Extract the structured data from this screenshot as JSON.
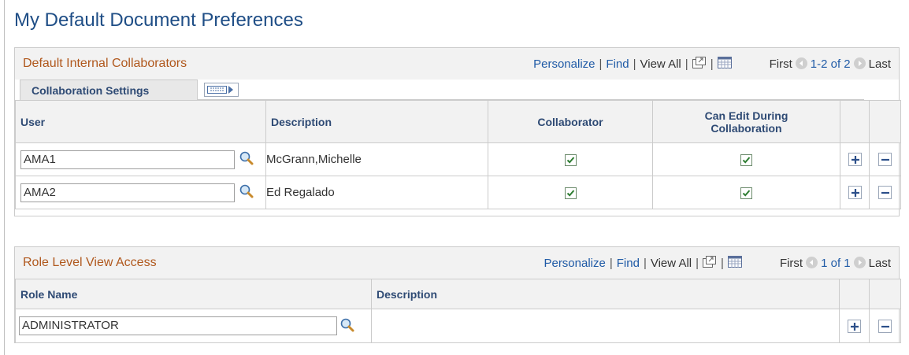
{
  "page": {
    "title": "My Default Document Preferences"
  },
  "collaborators": {
    "title": "Default Internal Collaborators",
    "nav": {
      "personalize": "Personalize",
      "find": "Find",
      "view_all": "View All",
      "first": "First",
      "range": "1-2 of 2",
      "last": "Last"
    },
    "tab": {
      "label": "Collaboration Settings"
    },
    "columns": {
      "user": "User",
      "description": "Description",
      "collaborator": "Collaborator",
      "can_edit_1": "Can Edit During",
      "can_edit_2": "Collaboration"
    },
    "rows": [
      {
        "user": "AMA1",
        "description": "McGrann,Michelle",
        "collaborator": true,
        "can_edit": true
      },
      {
        "user": "AMA2",
        "description": "Ed Regalado",
        "collaborator": true,
        "can_edit": true
      }
    ]
  },
  "roles": {
    "title": "Role Level View Access",
    "nav": {
      "personalize": "Personalize",
      "find": "Find",
      "view_all": "View All",
      "first": "First",
      "range": "1 of 1",
      "last": "Last"
    },
    "columns": {
      "role_name": "Role Name",
      "description": "Description"
    },
    "rows": [
      {
        "role_name": "ADMINISTRATOR",
        "description": ""
      }
    ]
  },
  "icons": {
    "lookup": "magnifier-icon",
    "zoom": "new-window-icon",
    "download": "download-grid-icon",
    "prev": "previous-arrow-icon",
    "next": "next-arrow-icon",
    "add": "add-row-icon",
    "delete": "delete-row-icon",
    "expand_tabs": "show-all-columns-icon",
    "checkbox": "checkmark-icon"
  },
  "colors": {
    "title": "#1f4e86",
    "section_title": "#b0581d",
    "link": "#1f5aa6",
    "header_bg": "#f2f2f2"
  }
}
